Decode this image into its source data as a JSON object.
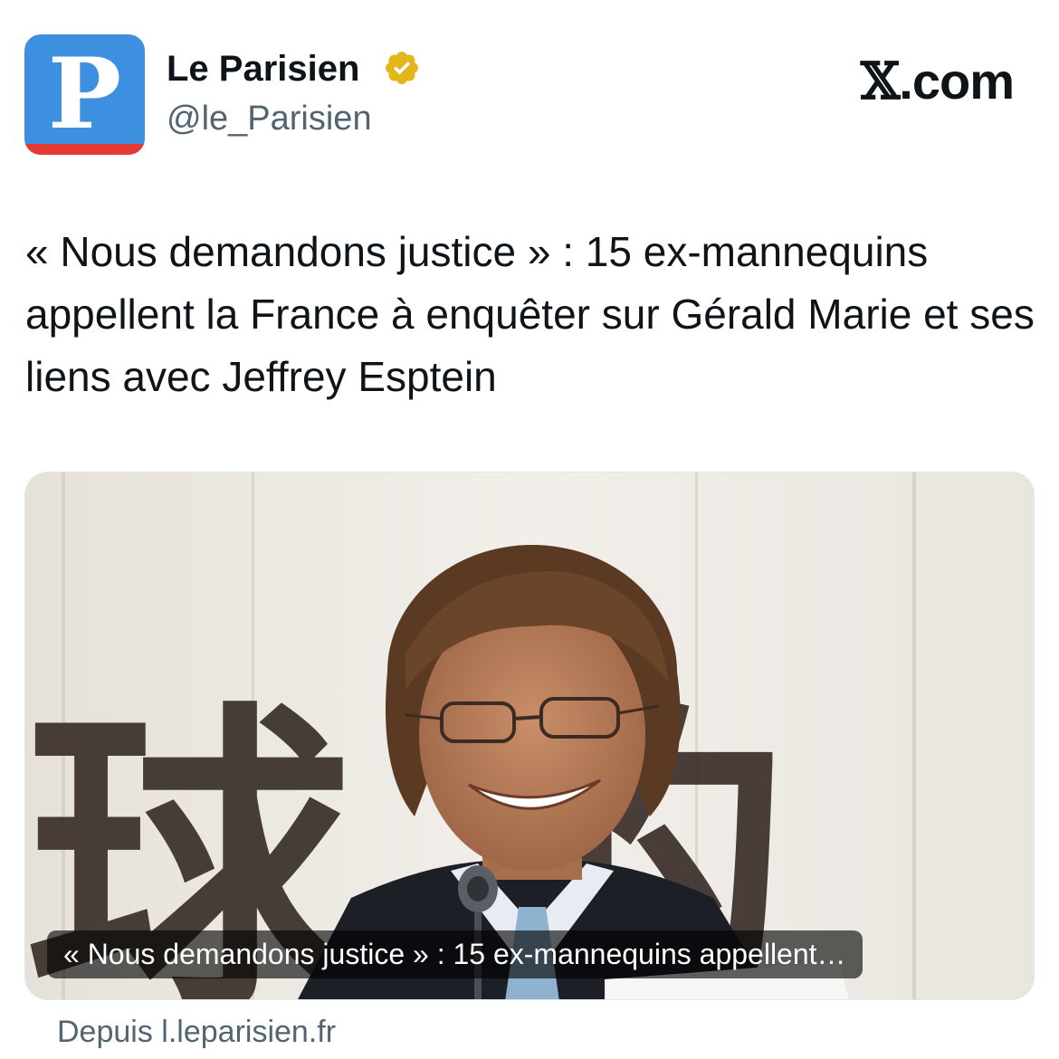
{
  "account": {
    "avatar_letter": "P",
    "display_name": "Le Parisien",
    "handle": "@le_Parisien",
    "verified_badge_icon": "verified-gold-badge-icon",
    "avatar_colors": {
      "background": "#3d8fe0",
      "stripe": "#e63a34"
    }
  },
  "brand": {
    "x_mark": "𝕏",
    "domain": ".com"
  },
  "tweet": {
    "text": "« Nous demandons justice » : 15 ex-mannequins appellent la France à enquêter sur Gérald Marie et ses liens avec Jeffrey Esptein"
  },
  "card": {
    "caption": "« Nous demandons justice » : 15 ex-mannequins appellent…",
    "source": "Depuis l.leparisien.fr",
    "background_chars": "球 的"
  },
  "colors": {
    "text_primary": "#0f1419",
    "text_secondary": "#536471",
    "verified_gold": "#e2b719"
  }
}
